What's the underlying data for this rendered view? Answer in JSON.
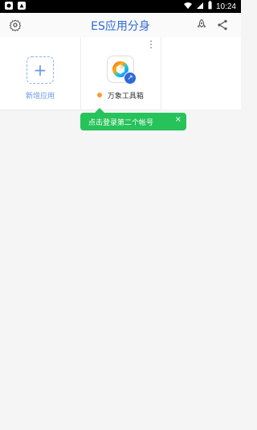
{
  "status": {
    "time": "10:24",
    "left_icons": [
      "settings-notification-icon",
      "app-notification-icon"
    ],
    "right_icons": [
      "wifi-icon",
      "signal-icon",
      "battery-icon"
    ]
  },
  "appbar": {
    "title": "ES应用分身",
    "left_icon": "settings-icon",
    "right_icons": [
      "rocket-icon",
      "share-icon"
    ]
  },
  "grid": {
    "tiles": [
      {
        "type": "add",
        "label": "新增应用",
        "accent": "#6b98ea"
      },
      {
        "type": "app",
        "label": "万象工具箱",
        "status_dot_color": "#ff9a2e",
        "badge_icon": "share-arrow-icon",
        "overflow_icon": "more-vertical-icon"
      }
    ]
  },
  "toast": {
    "text": "点击登录第二个帐号",
    "close_label": "×",
    "color": "#26c25a"
  }
}
